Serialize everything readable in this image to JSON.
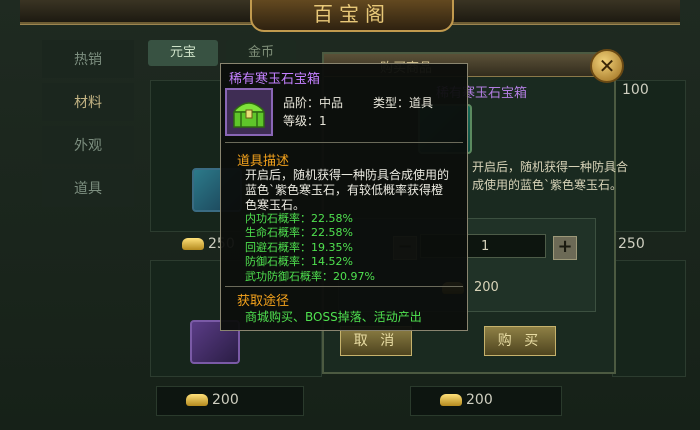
{
  "header": {
    "title": "百宝阁"
  },
  "nav": {
    "items": [
      {
        "label": "热销",
        "active": false
      },
      {
        "label": "材料",
        "active": true
      },
      {
        "label": "外观",
        "active": false
      },
      {
        "label": "道具",
        "active": false
      }
    ]
  },
  "currency_tabs": [
    {
      "label": "元宝"
    },
    {
      "label": "金币"
    }
  ],
  "shop_prices": {
    "right_top": "100",
    "right_mid": "250",
    "left_mid": "250",
    "bottom_left": "200",
    "bottom_right": "200"
  },
  "purchase_dialog": {
    "title": "购买商品",
    "item_name": "稀有寒玉石宝箱",
    "description": "开启后，随机获得一种防具合成使用的蓝色`紫色寒玉石。",
    "quantity": "1",
    "total_price": "200",
    "cancel_label": "取 消",
    "buy_label": "购 买",
    "minus": "−",
    "plus": "+"
  },
  "tooltip": {
    "name": "稀有寒玉石宝箱",
    "grade_label": "品阶：中品",
    "type_label": "类型：道具",
    "level_label": "等级：1",
    "desc_heading": "道具描述",
    "description": "开启后，随机获得一种防具合成使用的蓝色`紫色寒玉石，有较低概率获得橙色寒玉石。",
    "rates": [
      "内功石概率：22.58%",
      "生命石概率：22.58%",
      "回避石概率：19.35%",
      "防御石概率：14.52%",
      "武功防御石概率：20.97%"
    ],
    "source_heading": "获取途径",
    "source": "商城购买、BOSS掉落、活动产出"
  }
}
